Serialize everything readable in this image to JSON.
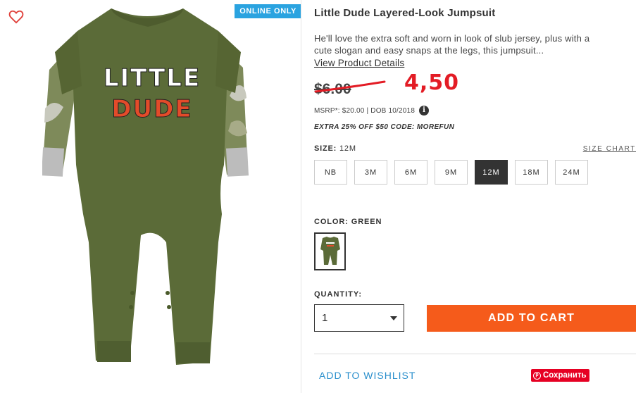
{
  "image_panel": {
    "badge": "ONLINE ONLY",
    "shirt_text_line1": "LITTLE",
    "shirt_text_line2": "DUDE",
    "product_color": "#5b6b38"
  },
  "product": {
    "title": "Little Dude Layered-Look Jumpsuit",
    "description": "He'll love the extra soft and worn in look of slub jersey, plus with a cute slogan and easy snaps at the legs, this jumpsuit...",
    "view_details": "View Product Details",
    "old_price": "$6.00",
    "handwritten_price": "4,50",
    "msrp": "MSRP*: $20.00 | DOB 10/2018",
    "info_icon": "i",
    "promo": "EXTRA 25% OFF $50 CODE: MOREFUN"
  },
  "size": {
    "label": "SIZE:",
    "selected": "12M",
    "chart_link": "SIZE CHART",
    "options": [
      "NB",
      "3M",
      "6M",
      "9M",
      "12M",
      "18M",
      "24M"
    ]
  },
  "color": {
    "label": "COLOR: GREEN"
  },
  "quantity": {
    "label": "QUANTITY:",
    "value": "1"
  },
  "actions": {
    "add_to_cart": "ADD TO CART",
    "wishlist": "ADD TO WISHLIST",
    "save": "Сохранить"
  },
  "colors": {
    "accent_orange": "#f55b1b",
    "badge_blue": "#2aa3e0",
    "link_blue": "#2a8fcc",
    "price_red": "#e31c25",
    "pinterest_red": "#e60023"
  }
}
